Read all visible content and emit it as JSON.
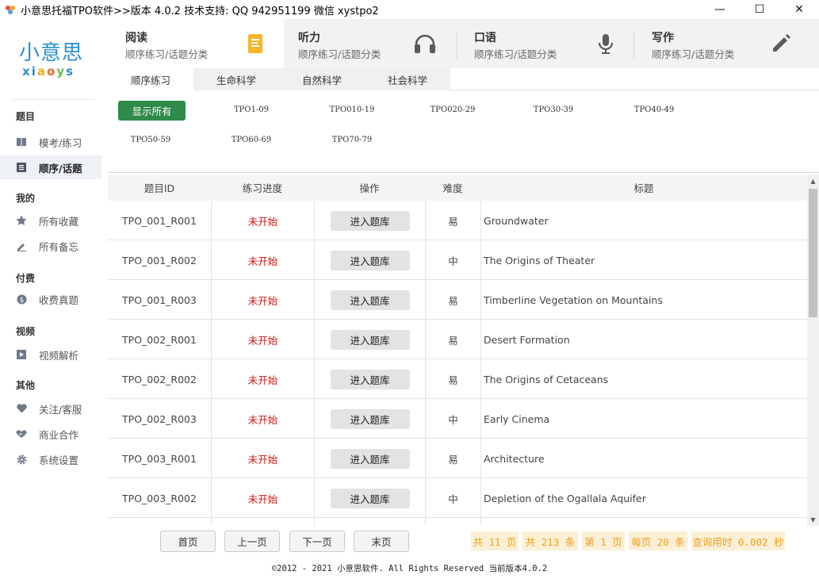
{
  "window": {
    "title": "小意思托福TPO软件>>版本 4.0.2 技术支持: QQ 942951199 微信 xystpo2",
    "minimize": "—",
    "maximize": "☐",
    "close": "✕"
  },
  "logo": {
    "cn": "小意思",
    "en_parts": [
      "x",
      "i",
      "a",
      "o",
      "y",
      "s"
    ]
  },
  "sidebar": {
    "groups": [
      "题目",
      "我的",
      "付费",
      "视频",
      "其他"
    ],
    "items": [
      {
        "label": "模考/练习",
        "icon": "book-icon"
      },
      {
        "label": "顺序/话题",
        "icon": "list-icon"
      },
      {
        "label": "所有收藏",
        "icon": "star-icon"
      },
      {
        "label": "所有备忘",
        "icon": "pencil-icon"
      },
      {
        "label": "收费真题",
        "icon": "dollar-icon"
      },
      {
        "label": "视频解析",
        "icon": "play-icon"
      },
      {
        "label": "关注/客服",
        "icon": "heart-icon"
      },
      {
        "label": "商业合作",
        "icon": "handshake-icon"
      },
      {
        "label": "系统设置",
        "icon": "gear-icon"
      }
    ]
  },
  "topnav": [
    {
      "title": "阅读",
      "sub": "顺序练习/话题分类",
      "icon": "document-icon"
    },
    {
      "title": "听力",
      "sub": "顺序练习/话题分类",
      "icon": "headphones-icon"
    },
    {
      "title": "口语",
      "sub": "顺序练习/话题分类",
      "icon": "microphone-icon"
    },
    {
      "title": "写作",
      "sub": "顺序练习/话题分类",
      "icon": "pen-icon"
    }
  ],
  "subtabs": [
    "顺序练习",
    "生命科学",
    "自然科学",
    "社会科学"
  ],
  "filters": {
    "show_all": "显示所有",
    "ranges": [
      "TPO1-09",
      "TPO010-19",
      "TPO020-29",
      "TPO30-39",
      "TPO40-49",
      "TPO50-59",
      "TPO60-69",
      "TPO70-79"
    ]
  },
  "table": {
    "headers": [
      "题目ID",
      "练习进度",
      "操作",
      "难度",
      "标题"
    ],
    "action_label": "进入题库",
    "rows": [
      {
        "id": "TPO_001_R001",
        "progress": "未开始",
        "difficulty": "易",
        "title": "Groundwater"
      },
      {
        "id": "TPO_001_R002",
        "progress": "未开始",
        "difficulty": "中",
        "title": "The Origins of Theater"
      },
      {
        "id": "TPO_001_R003",
        "progress": "未开始",
        "difficulty": "易",
        "title": "Timberline Vegetation on Mountains"
      },
      {
        "id": "TPO_002_R001",
        "progress": "未开始",
        "difficulty": "易",
        "title": "Desert Formation"
      },
      {
        "id": "TPO_002_R002",
        "progress": "未开始",
        "difficulty": "易",
        "title": "The Origins of Cetaceans"
      },
      {
        "id": "TPO_002_R003",
        "progress": "未开始",
        "difficulty": "中",
        "title": "Early Cinema"
      },
      {
        "id": "TPO_003_R001",
        "progress": "未开始",
        "difficulty": "易",
        "title": "Architecture"
      },
      {
        "id": "TPO_003_R002",
        "progress": "未开始",
        "difficulty": "中",
        "title": "Depletion of the Ogallala Aquifer"
      },
      {
        "id": "",
        "progress": "",
        "difficulty": "",
        "title": ""
      }
    ]
  },
  "pager": {
    "first": "首页",
    "prev": "上一页",
    "next": "下一页",
    "last": "末页",
    "total_pages": "共 11 页",
    "total_items": "共 213 条",
    "current": "第 1 页",
    "per_page": "每页 20 条",
    "query_time": "查询用时 0.002 秒"
  },
  "footer": "©2012 - 2021 小意思软件. All Rights Reserved 当前版本4.0.2",
  "colors": {
    "accent_green": "#2f8a4b",
    "status_red": "#d31414",
    "brand_blue": "#2a8fd0",
    "pager_orange": "#f0a020"
  }
}
